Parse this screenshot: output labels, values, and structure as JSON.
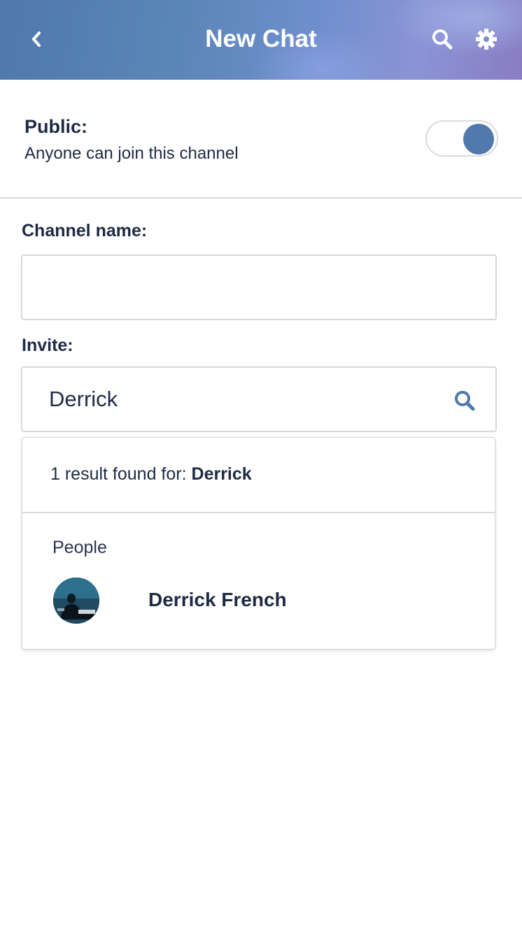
{
  "header": {
    "title": "New Chat",
    "back_icon": "chevron-left-icon",
    "search_icon": "search-icon",
    "settings_icon": "gear-icon"
  },
  "public_setting": {
    "label": "Public:",
    "description": "Anyone can join this channel",
    "enabled": true
  },
  "channel_name": {
    "label": "Channel name:",
    "value": "",
    "placeholder": ""
  },
  "invite": {
    "label": "Invite:",
    "value": "Derrick",
    "search_icon": "search-icon"
  },
  "results": {
    "summary_prefix": "1 result found for: ",
    "query": "Derrick",
    "section_label": "People",
    "people": [
      {
        "name": "Derrick French"
      }
    ]
  },
  "colors": {
    "accent": "#5179ad",
    "text": "#1f2a44",
    "divider": "#d7d9de"
  }
}
